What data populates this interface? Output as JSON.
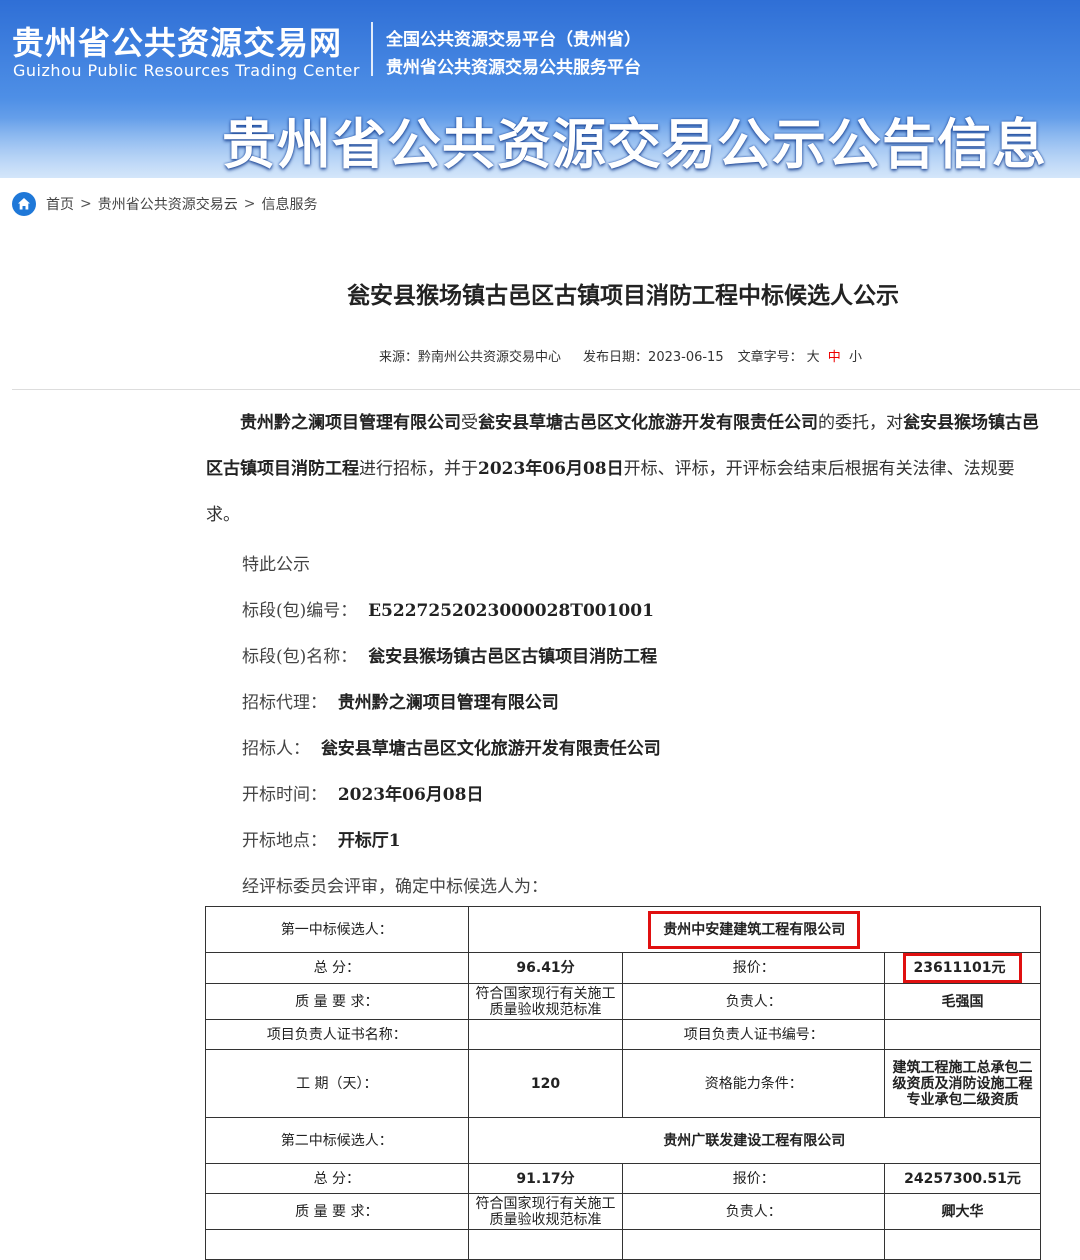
{
  "banner": {
    "site_name_cn": "贵州省公共资源交易网",
    "site_name_en": "Guizhou Public Resources Trading Center",
    "platform_line1": "全国公共资源交易平台（贵州省）",
    "platform_line2": "贵州省公共资源交易公共服务平台",
    "page_heading": "贵州省公共资源交易公示公告信息"
  },
  "breadcrumb": {
    "items": [
      "首页",
      "贵州省公共资源交易云",
      "信息服务"
    ],
    "separator": ">"
  },
  "article": {
    "title": "瓮安县猴场镇古邑区古镇项目消防工程中标候选人公示",
    "source_label": "来源：",
    "source": "黔南州公共资源交易中心",
    "date_label": "发布日期：",
    "date": "2023-06-15",
    "fontsize_label": "文章字号：",
    "size_large": "大",
    "size_medium": "中",
    "size_small": "小",
    "intro": {
      "agent": "贵州黔之澜项目管理有限公司",
      "t1": "受",
      "owner": "瓮安县草塘古邑区文化旅游开发有限责任公司",
      "t2": "的委托，对",
      "project": "瓮安县猴场镇古邑区古镇项目消防工程",
      "t3": "进行招标，并于",
      "open_date": "2023年06月08日",
      "t4": "开标、评标，开评标会结束后根据有关法律、法规要求。"
    },
    "notice": "特此公示",
    "fields": [
      {
        "label": "标段(包)编号：",
        "value": "E5227252023000028T001001"
      },
      {
        "label": "标段(包)名称：",
        "value": "瓮安县猴场镇古邑区古镇项目消防工程"
      },
      {
        "label": "招标代理：",
        "value": "贵州黔之澜项目管理有限公司"
      },
      {
        "label": "招标人：",
        "value": "瓮安县草塘古邑区文化旅游开发有限责任公司"
      },
      {
        "label": "开标时间：",
        "value": "2023年06月08日"
      },
      {
        "label": "开标地点：",
        "value": "开标厅1"
      }
    ],
    "conclusion": "经评标委员会评审，确定中标候选人为："
  },
  "table": {
    "c1": {
      "rank_label": "第一中标候选人：",
      "name": "贵州中安建建筑工程有限公司",
      "score_label": "总 分：",
      "score": "96.41分",
      "price_label": "报价：",
      "price": "23611101元",
      "quality_label": "质 量 要 求：",
      "quality": "符合国家现行有关施工质量验收规范标准",
      "manager_label": "负责人：",
      "manager": "毛强国",
      "cert_name_label": "项目负责人证书名称：",
      "cert_no_label": "项目负责人证书编号：",
      "period_label": "工 期（天）：",
      "period": "120",
      "qual_label": "资格能力条件：",
      "qual": "建筑工程施工总承包二级资质及消防设施工程专业承包二级资质"
    },
    "c2": {
      "rank_label": "第二中标候选人：",
      "name": "贵州广联发建设工程有限公司",
      "score_label": "总 分：",
      "score": "91.17分",
      "price_label": "报价：",
      "price": "24257300.51元",
      "quality_label": "质 量 要 求：",
      "quality": "符合国家现行有关施工质量验收规范标准",
      "manager_label": "负责人：",
      "manager": "卿大华"
    }
  }
}
